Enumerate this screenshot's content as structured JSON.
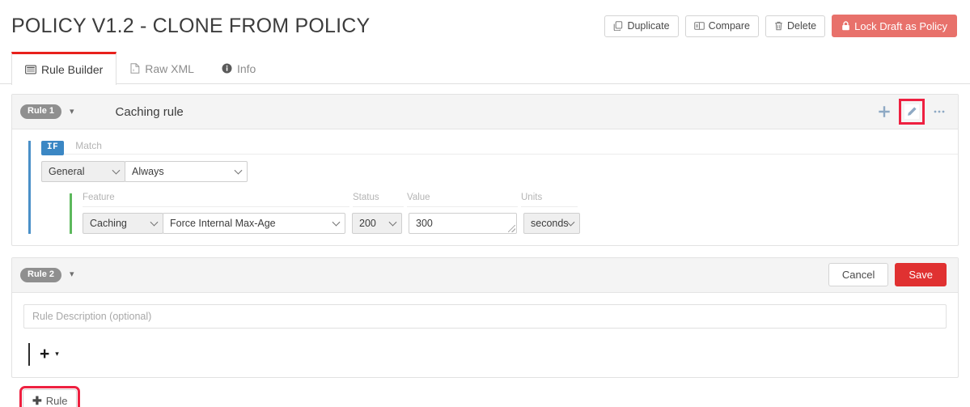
{
  "header": {
    "title": "POLICY V1.2 - CLONE FROM POLICY",
    "actions": [
      {
        "label": "Duplicate",
        "icon": "duplicate-icon"
      },
      {
        "label": "Compare",
        "icon": "compare-icon"
      },
      {
        "label": "Delete",
        "icon": "trash-icon"
      }
    ],
    "primary_action": {
      "label": "Lock Draft as Policy",
      "icon": "lock-icon",
      "color": "#e8716b"
    }
  },
  "tabs": [
    {
      "label": "Rule Builder",
      "icon": "rule-builder-icon",
      "active": true
    },
    {
      "label": "Raw XML",
      "icon": "xml-file-icon",
      "active": false
    },
    {
      "label": "Info",
      "icon": "info-icon",
      "active": false
    }
  ],
  "rules": [
    {
      "badge": "Rule 1",
      "name": "Caching rule",
      "head_icons": [
        "plus-icon",
        "edit-pencil-icon",
        "ellipsis-icon"
      ],
      "condition": {
        "if_badge": "IF",
        "match_label": "Match",
        "scope": "General",
        "operator": "Always"
      },
      "action": {
        "labels": {
          "feature": "Feature",
          "status": "Status",
          "value": "Value",
          "units": "Units"
        },
        "feature": "Caching",
        "behavior": "Force Internal Max-Age",
        "status": "200",
        "value": "300",
        "units": "seconds"
      }
    },
    {
      "badge": "Rule 2",
      "description_placeholder": "Rule Description (optional)",
      "add_label": "+",
      "footer": {
        "cancel_label": "Cancel",
        "save_label": "Save",
        "save_color": "#e03131"
      }
    }
  ],
  "add_rule_button": {
    "label": "Rule",
    "icon": "plus-icon"
  },
  "colors": {
    "accent_red": "#e8211c",
    "condition_bar": "#4a90c8",
    "action_bar": "#5cb85c",
    "badge_gray": "#8f8f8f",
    "if_blue": "#3b87c4",
    "annotation": "#ee2040"
  }
}
